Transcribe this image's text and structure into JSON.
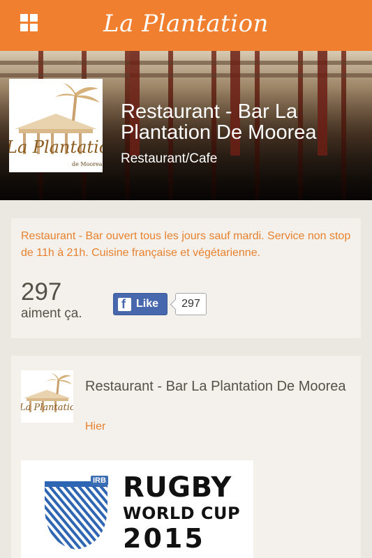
{
  "app": {
    "title": "La Plantation",
    "menu_icon": "grid-menu-icon"
  },
  "cover": {
    "page_name": "Restaurant - Bar La Plantation De Moorea",
    "category": "Restaurant/Cafe",
    "logo_text": "La Plantation",
    "logo_subtext": "de Moorea"
  },
  "about": {
    "text": "Restaurant - Bar ouvert tous les jours sauf mardi. Service non stop de 11h à 21h. Cuisine française et végétarienne.",
    "likes_count": "297",
    "likes_label": "aiment ça.",
    "like_button_label": "Like",
    "like_button_count": "297"
  },
  "post": {
    "author": "Restaurant - Bar La Plantation De Moorea",
    "time": "Hier",
    "image_text": {
      "badge": "IRB",
      "line1": "RUGBY",
      "line2": "WORLD CUP",
      "line3": "2015"
    }
  },
  "colors": {
    "accent": "#f07f2f",
    "accent_text": "#e8812e",
    "facebook": "#4868ad",
    "background": "#ebe7e1",
    "card": "#f4f1ec"
  }
}
